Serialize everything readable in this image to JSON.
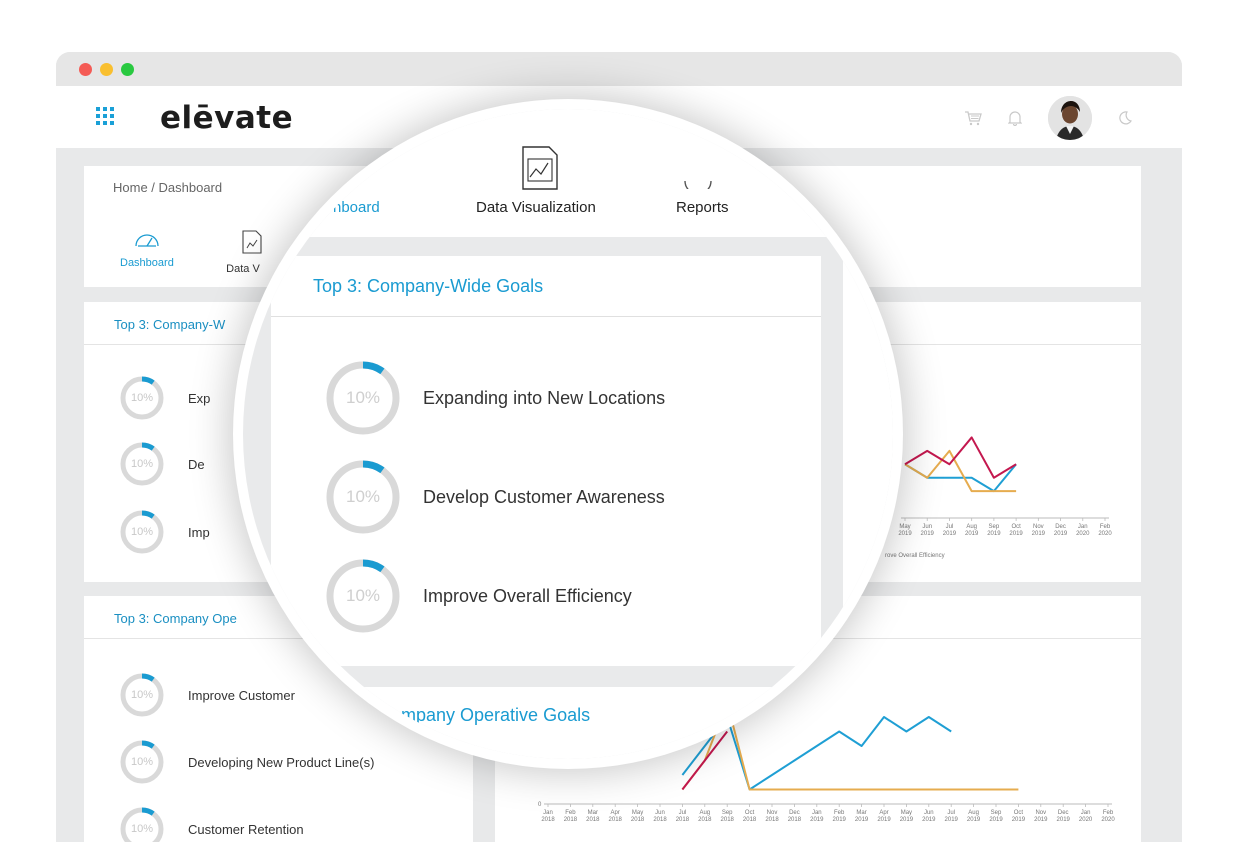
{
  "app": {
    "logo_text": "elēvate"
  },
  "breadcrumb": "Home / Dashboard",
  "nav": {
    "dashboard": "Dashboard",
    "data_visualization": "Data Visualization",
    "data_visualization_clipped": "Data V",
    "reports": "Reports"
  },
  "company_wide": {
    "title": "Top 3: Company-Wide Goals",
    "title_clipped": "Top 3: Company-W",
    "goals": [
      {
        "label": "Expanding into New Locations",
        "clipped": "Exp",
        "percent": "10%",
        "progress": 0.1
      },
      {
        "label": "Develop Customer Awareness",
        "clipped": "De",
        "percent": "10%",
        "progress": 0.1
      },
      {
        "label": "Improve Overall Efficiency",
        "clipped": "Imp",
        "percent": "10%",
        "progress": 0.1
      }
    ]
  },
  "operative": {
    "title": "Top 3: Company Operative Goals",
    "title_clipped": "Top 3: Company Ope",
    "title_mag_clipped": "mpany Operative Goals",
    "goals": [
      {
        "label": "Improve Customer",
        "percent": "10%",
        "progress": 0.1
      },
      {
        "label": "Developing New Product Line(s)",
        "percent": "10%",
        "progress": 0.1
      },
      {
        "label": "Customer Retention",
        "percent": "10%",
        "progress": 0.1
      }
    ]
  },
  "mag_nav_clipped": "hboard",
  "icons": {
    "grid": "apps-grid-icon",
    "cart": "cart-icon",
    "bell": "bell-icon",
    "moon": "moon-icon",
    "gauge": "gauge-icon",
    "chart_doc": "chart-document-icon"
  },
  "colors": {
    "accent": "#1a9bd1",
    "series_blue": "#1f9fd4",
    "series_orange": "#e6ac4f",
    "series_crimson": "#c4184f",
    "ring_track": "#d9d9d9"
  },
  "chart_data": [
    {
      "type": "line",
      "x": [
        "May 2019",
        "Jun 2019",
        "Jul 2019",
        "Aug 2019",
        "Sep 2019",
        "Oct 2019",
        "Nov 2019",
        "Dec 2019",
        "Jan 2020",
        "Feb 2020"
      ],
      "series": [
        {
          "values": [
            4,
            3,
            3,
            3,
            2,
            4,
            null,
            null,
            null,
            null
          ],
          "color": "#1f9fd4"
        },
        {
          "values": [
            4,
            3,
            5,
            2,
            2,
            2,
            null,
            null,
            null,
            null
          ],
          "color": "#e6ac4f"
        },
        {
          "values": [
            4,
            5,
            4,
            6,
            3,
            4,
            null,
            null,
            null,
            null
          ],
          "color": "#c4184f"
        }
      ],
      "legend_clipped": "rove Overall Efficiency"
    },
    {
      "type": "line",
      "x": [
        "Jan 2018",
        "Feb 2018",
        "Mar 2018",
        "Apr 2018",
        "May 2018",
        "Jun 2018",
        "Jul 2018",
        "Aug 2018",
        "Sep 2018",
        "Oct 2018",
        "Nov 2018",
        "Dec 2018",
        "Jan 2019",
        "Feb 2019",
        "Mar 2019",
        "Apr 2019",
        "May 2019",
        "Jun 2019",
        "Jul 2019",
        "Aug 2019",
        "Sep 2019",
        "Oct 2019",
        "Nov 2019",
        "Dec 2019",
        "Jan 2020",
        "Feb 2020"
      ],
      "y_tick": "0",
      "series": [
        {
          "values": [
            null,
            null,
            null,
            null,
            null,
            null,
            2,
            4,
            6,
            1,
            2,
            3,
            4,
            5,
            4,
            6,
            5,
            6,
            5,
            null,
            null,
            null,
            null,
            null,
            null,
            null
          ],
          "color": "#1f9fd4"
        },
        {
          "values": [
            null,
            null,
            null,
            null,
            null,
            null,
            1,
            3,
            7,
            1,
            1,
            1,
            1,
            1,
            1,
            1,
            1,
            1,
            1,
            1,
            1,
            1,
            null,
            null,
            null,
            null
          ],
          "color": "#e6ac4f"
        },
        {
          "values": [
            null,
            null,
            null,
            null,
            null,
            null,
            1,
            3,
            5,
            null,
            null,
            null,
            null,
            null,
            null,
            null,
            null,
            null,
            null,
            null,
            null,
            null,
            null,
            null,
            null,
            null
          ],
          "color": "#c4184f"
        }
      ]
    }
  ]
}
